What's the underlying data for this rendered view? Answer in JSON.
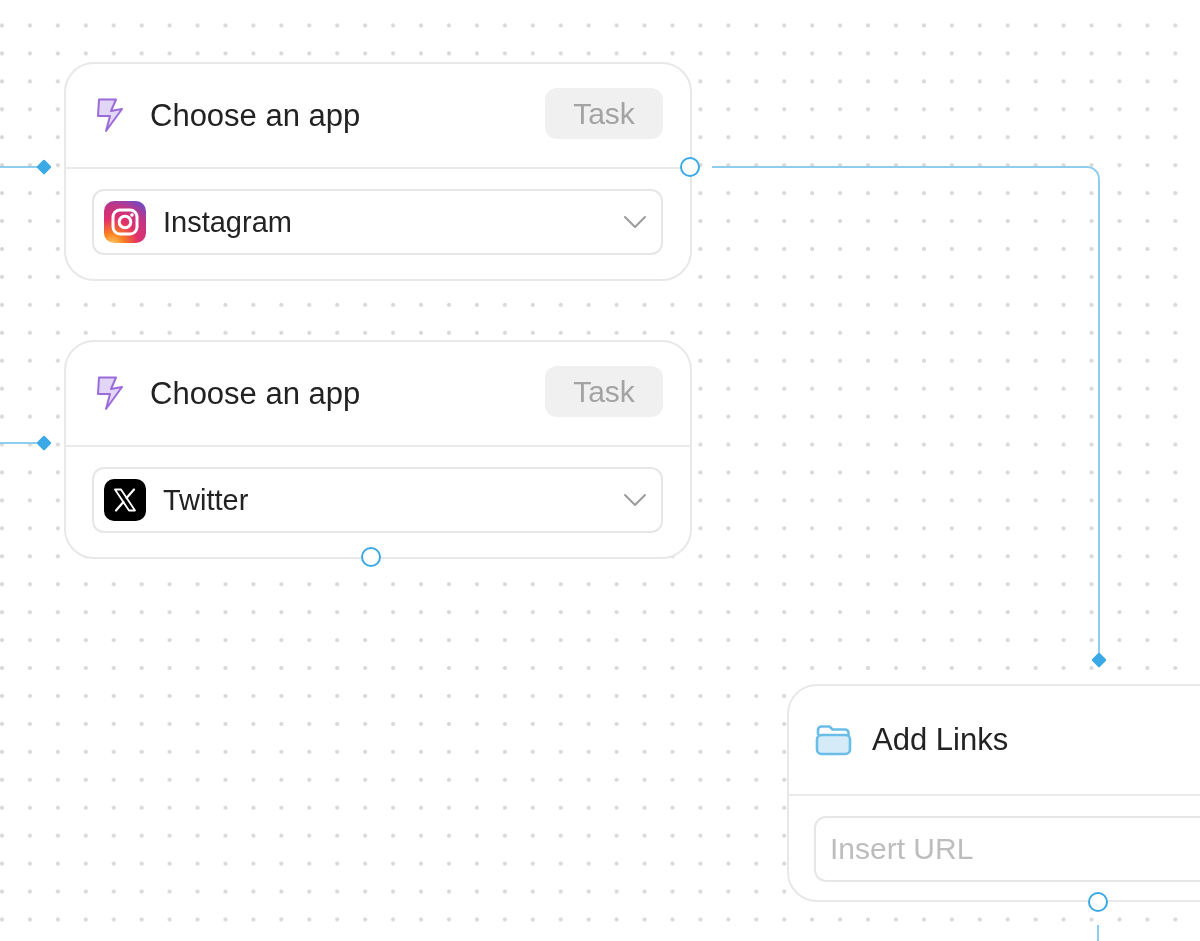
{
  "canvas": {
    "nodes": [
      {
        "kind": "app_select",
        "title": "Choose an app",
        "badge": "Task",
        "select": {
          "value": "Instagram"
        }
      },
      {
        "kind": "app_select",
        "title": "Choose an app",
        "badge": "Task",
        "select": {
          "value": "Twitter"
        }
      },
      {
        "kind": "link_input",
        "title": "Add Links",
        "input": {
          "placeholder": "Insert URL"
        }
      }
    ]
  }
}
